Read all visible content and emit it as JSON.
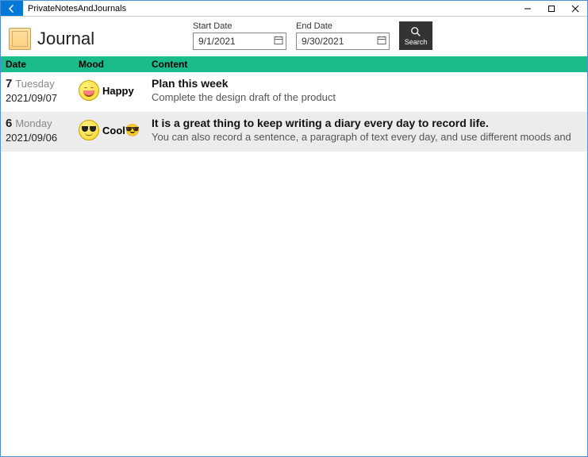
{
  "window": {
    "title": "PrivateNotesAndJournals"
  },
  "header": {
    "page_title": "Journal",
    "start_label": "Start Date",
    "start_value": "9/1/2021",
    "end_label": "End Date",
    "end_value": "9/30/2021",
    "search_label": "Search"
  },
  "columns": {
    "date": "Date",
    "mood": "Mood",
    "content": "Content"
  },
  "entries": [
    {
      "day_num": "7",
      "day_name": "Tuesday",
      "full_date": "2021/09/07",
      "mood_label": "Happy",
      "mood_kind": "happy",
      "mood_extra": "",
      "title": "Plan this week",
      "body": "Complete the design draft of the product",
      "selected": false
    },
    {
      "day_num": "6",
      "day_name": "Monday",
      "full_date": "2021/09/06",
      "mood_label": "Cool",
      "mood_kind": "cool",
      "mood_extra": "😎",
      "title": "It is a great thing to keep writing a diary every day to record life.",
      "body": "You can also record a sentence, a paragraph of text every day, and use different moods and",
      "selected": true
    }
  ]
}
